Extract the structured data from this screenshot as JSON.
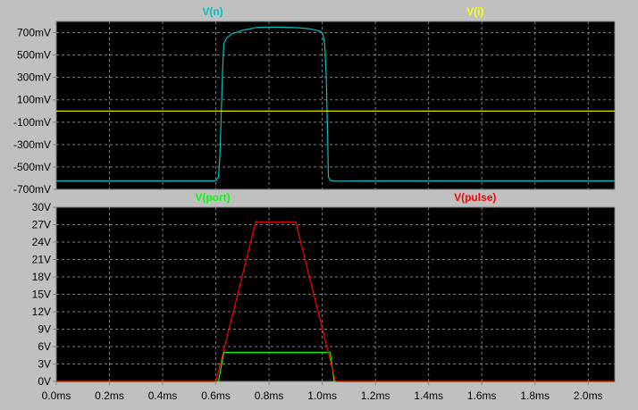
{
  "colors": {
    "window_bg": "#c0c0c0",
    "plot_bg": "#000000",
    "grid": "#808080",
    "frame": "#808080",
    "tick_text": "#000000"
  },
  "chart_data": [
    {
      "type": "line",
      "pane": "top",
      "legend_position": "top",
      "grid": true,
      "grid_style": "dashed",
      "xlim": [
        0,
        2.1
      ],
      "x_unit": "ms",
      "ylim": [
        -700,
        800
      ],
      "y_unit": "mV",
      "yticks": [
        -700,
        -500,
        -300,
        -100,
        100,
        300,
        500,
        700
      ],
      "ytick_labels": [
        "-700mV",
        "-500mV",
        "-300mV",
        "-100mV",
        "100mV",
        "300mV",
        "500mV",
        "700mV"
      ],
      "series": [
        {
          "name": "V(n)",
          "color": "#00c0c0",
          "x": [
            0.0,
            0.6,
            0.6,
            0.61,
            0.615,
            0.62,
            0.625,
            0.63,
            0.64,
            0.65,
            0.66,
            0.7,
            0.75,
            0.8,
            0.85,
            0.9,
            0.95,
            0.99,
            1.0,
            1.005,
            1.01,
            1.015,
            1.02,
            1.023,
            1.03,
            1.045,
            1.06,
            1.2,
            2.1
          ],
          "y": [
            -624,
            -624,
            -624,
            -590,
            -420,
            -50,
            350,
            600,
            650,
            670,
            690,
            720,
            745,
            750,
            748,
            745,
            735,
            715,
            700,
            660,
            580,
            300,
            -200,
            -590,
            -620,
            -626,
            -626,
            -624,
            -624
          ]
        },
        {
          "name": "V(i)",
          "color": "#ffff00",
          "x": [
            0.0,
            2.1
          ],
          "y": [
            0,
            0
          ]
        }
      ]
    },
    {
      "type": "line",
      "pane": "bottom",
      "legend_position": "top",
      "grid": true,
      "grid_style": "dashed",
      "xlim": [
        0,
        2.1
      ],
      "x_unit": "ms",
      "ylim": [
        0,
        30
      ],
      "y_unit": "V",
      "yticks": [
        0,
        3,
        6,
        9,
        12,
        15,
        18,
        21,
        24,
        27,
        30
      ],
      "ytick_labels": [
        "0V",
        "3V",
        "6V",
        "9V",
        "12V",
        "15V",
        "18V",
        "21V",
        "24V",
        "27V",
        "30V"
      ],
      "xticks": [
        0.0,
        0.2,
        0.4,
        0.6,
        0.8,
        1.0,
        1.2,
        1.4,
        1.6,
        1.8,
        2.0
      ],
      "xtick_labels": [
        "0.0ms",
        "0.2ms",
        "0.4ms",
        "0.6ms",
        "0.8ms",
        "1.0ms",
        "1.2ms",
        "1.4ms",
        "1.6ms",
        "1.8ms",
        "2.0ms"
      ],
      "series": [
        {
          "name": "V(port)",
          "color": "#00ff00",
          "x": [
            0.0,
            0.61,
            0.63,
            1.03,
            1.045,
            2.1
          ],
          "y": [
            0,
            0,
            5,
            5,
            0,
            0
          ]
        },
        {
          "name": "V(pulse)",
          "color": "#ff0000",
          "x": [
            0.0,
            0.6,
            0.75,
            0.9,
            1.05,
            2.1
          ],
          "y": [
            0,
            0,
            27.5,
            27.5,
            0,
            0
          ]
        }
      ]
    }
  ]
}
